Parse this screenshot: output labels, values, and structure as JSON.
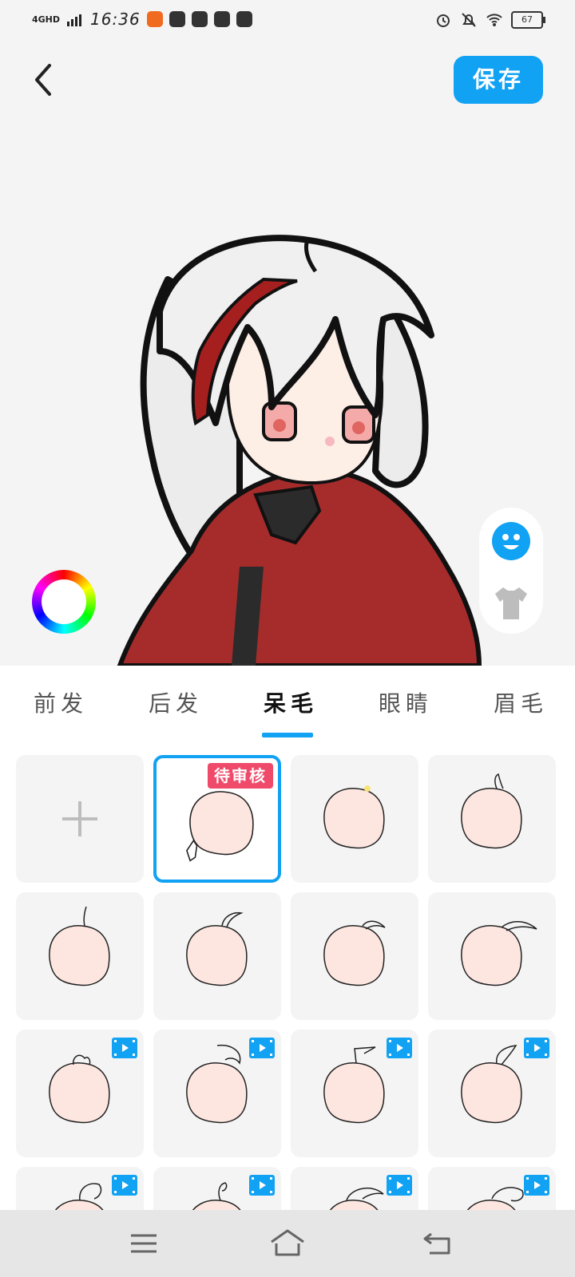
{
  "status_bar": {
    "network": "4GHD",
    "time": "16:36",
    "battery": "67"
  },
  "header": {
    "save_label": "保存"
  },
  "tabs": [
    {
      "label": "前发",
      "active": false
    },
    {
      "label": "后发",
      "active": false
    },
    {
      "label": "呆毛",
      "active": true
    },
    {
      "label": "眼睛",
      "active": false
    },
    {
      "label": "眉毛",
      "active": false
    }
  ],
  "grid": {
    "pending_badge": "待审核",
    "items": [
      {
        "type": "add"
      },
      {
        "type": "custom",
        "badge": "pending"
      },
      {
        "type": "ahoge",
        "video": false
      },
      {
        "type": "ahoge",
        "video": false
      },
      {
        "type": "ahoge",
        "video": false
      },
      {
        "type": "ahoge",
        "video": false
      },
      {
        "type": "ahoge",
        "video": false
      },
      {
        "type": "ahoge",
        "video": false
      },
      {
        "type": "ahoge",
        "video": true
      },
      {
        "type": "ahoge",
        "video": true
      },
      {
        "type": "ahoge",
        "video": true
      },
      {
        "type": "ahoge",
        "video": true
      },
      {
        "type": "ahoge",
        "video": true
      },
      {
        "type": "ahoge",
        "video": true
      },
      {
        "type": "ahoge",
        "video": true
      },
      {
        "type": "ahoge",
        "video": true
      }
    ]
  },
  "colors": {
    "accent": "#11a2f4",
    "badge": "#f04a6b"
  }
}
